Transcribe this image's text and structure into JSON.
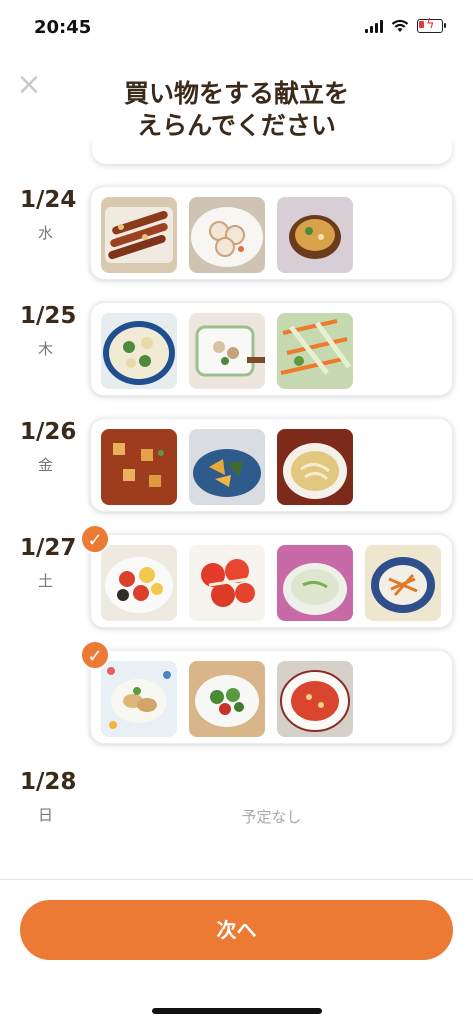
{
  "status_bar": {
    "time": "20:45"
  },
  "header": {
    "close_icon": "close-icon",
    "title_line1": "買い物をする献立を",
    "title_line2": "えらんでください"
  },
  "days": [
    {
      "date": "1/24",
      "weekday": "水"
    },
    {
      "date": "1/25",
      "weekday": "木"
    },
    {
      "date": "1/26",
      "weekday": "金"
    },
    {
      "date": "1/27",
      "weekday": "土"
    },
    {
      "date": "1/28",
      "weekday": "日",
      "empty_text": "予定なし"
    }
  ],
  "meals": [
    {
      "day": "1/24",
      "selected": false,
      "dishes": [
        "grilled-skewers",
        "lotus-root-salad",
        "miso-soup"
      ]
    },
    {
      "day": "1/25",
      "selected": false,
      "dishes": [
        "cream-stew",
        "chicken-salad",
        "carrot-cabbage-salad"
      ]
    },
    {
      "day": "1/26",
      "selected": false,
      "dishes": [
        "mapo-potatoes",
        "simmered-pumpkin",
        "egg-soup"
      ]
    },
    {
      "day": "1/27",
      "selected": true,
      "dishes": [
        "tomato-egg-stir-fry",
        "sliced-tomatoes",
        "clear-soup",
        "carrot-salad"
      ]
    },
    {
      "day": "1/27",
      "selected": true,
      "dishes": [
        "sauteed-chicken",
        "green-salad",
        "tomato-soup"
      ]
    }
  ],
  "footer": {
    "next_label": "次へ"
  },
  "colors": {
    "accent": "#ec7a35",
    "title": "#3b2a1a"
  }
}
